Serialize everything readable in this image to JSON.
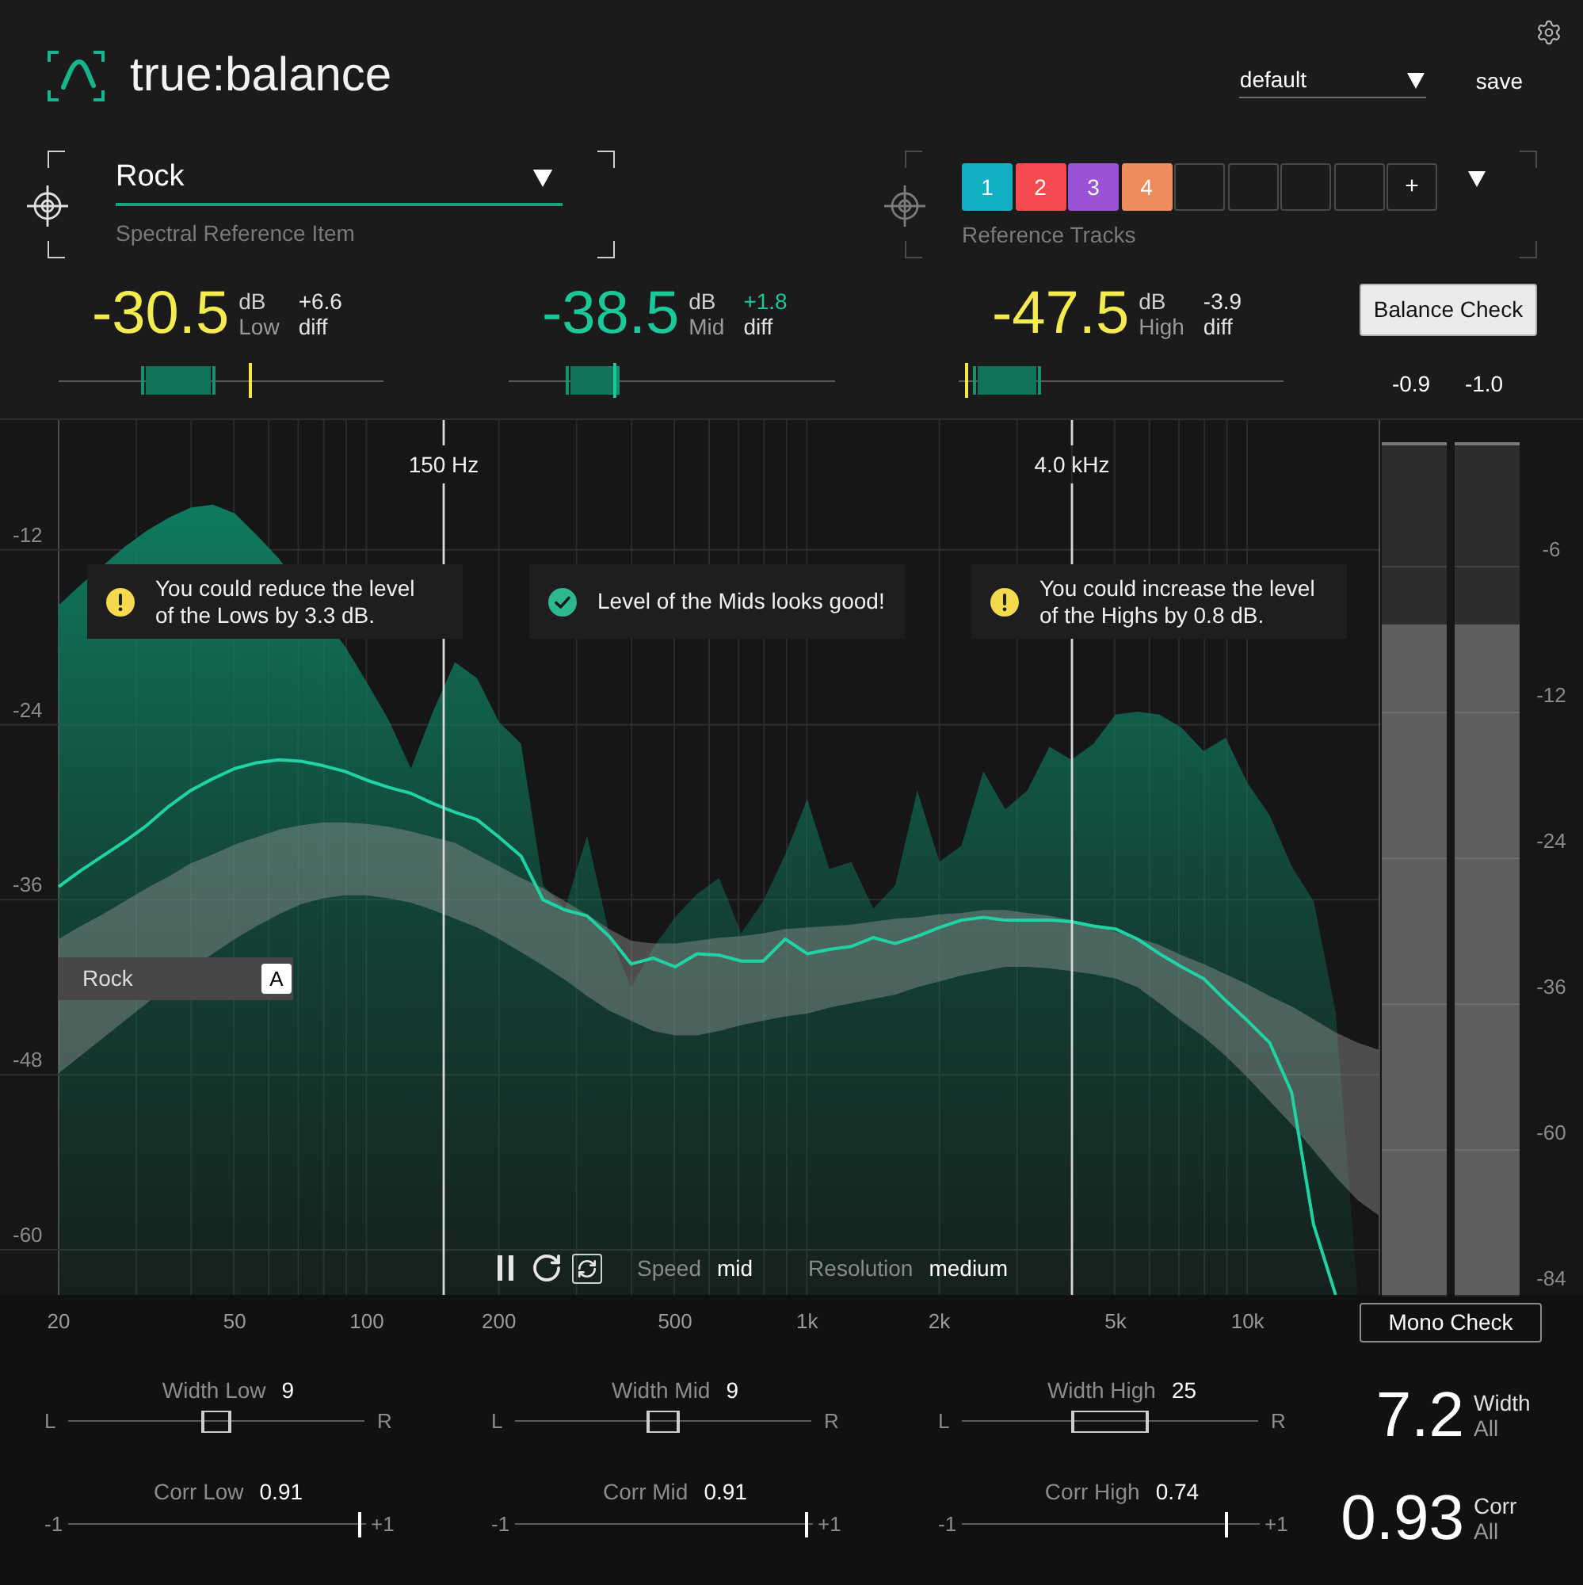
{
  "app": {
    "title": "true:balance"
  },
  "preset": {
    "value": "default"
  },
  "save_button": "save",
  "spectral_reference": {
    "value": "Rock",
    "label": "Spectral Reference Item"
  },
  "reference_tracks": {
    "label": "Reference Tracks",
    "slots": [
      {
        "kind": "track",
        "label": "1",
        "color": "#12b0c3"
      },
      {
        "kind": "track",
        "label": "2",
        "color": "#f34b4f"
      },
      {
        "kind": "track",
        "label": "3",
        "color": "#9c52d6"
      },
      {
        "kind": "track",
        "label": "4",
        "color": "#ee8c5c"
      },
      {
        "kind": "empty"
      },
      {
        "kind": "empty"
      },
      {
        "kind": "empty"
      },
      {
        "kind": "empty"
      },
      {
        "kind": "add",
        "label": "+"
      }
    ]
  },
  "band_meters": [
    {
      "value": "-30.5",
      "unit": "dB",
      "band": "Low",
      "diff": "+6.6",
      "diff_label": "diff",
      "on_target": false,
      "range_start": {
        "level": 0.26
      },
      "range_end": {
        "level": 0.48
      },
      "marker": {
        "level": 0.59
      }
    },
    {
      "value": "-38.5",
      "unit": "dB",
      "band": "Mid",
      "diff": "+1.8",
      "diff_label": "diff",
      "on_target": true,
      "range_start": {
        "level": 0.18
      },
      "range_end": {
        "level": 0.335
      },
      "marker": {
        "level": 0.325
      }
    },
    {
      "value": "-47.5",
      "unit": "dB",
      "band": "High",
      "diff": "-3.9",
      "diff_label": "diff",
      "on_target": false,
      "range_start": {
        "level": 0.05
      },
      "range_end": {
        "level": 0.25
      },
      "marker": {
        "level": 0.024
      }
    }
  ],
  "balance_check": "Balance Check",
  "output_meter": {
    "channels": [
      {
        "reading": "-0.9",
        "level": 0.79
      },
      {
        "reading": "-1.0",
        "level": 0.79
      }
    ],
    "scale": [
      "-6",
      "-12",
      "-24",
      "-36",
      "-60",
      "-84"
    ]
  },
  "spectrum": {
    "crossovers": [
      {
        "label": "150 Hz"
      },
      {
        "label": "4.0 kHz"
      }
    ],
    "hints": [
      {
        "kind": "warning",
        "lines": [
          "You could reduce the level",
          "of the Lows by 3.3 dB."
        ]
      },
      {
        "kind": "ok",
        "lines": [
          "Level of the Mids looks good!"
        ]
      },
      {
        "kind": "warning",
        "lines": [
          "You could increase the level",
          "of the Highs by 0.8 dB."
        ]
      }
    ],
    "reference_tag": {
      "text": "Rock",
      "badge": "A"
    },
    "controls": [
      {
        "label": "Speed",
        "value": "mid"
      },
      {
        "label": "Resolution",
        "value": "medium"
      }
    ],
    "chart_data": {
      "type": "area",
      "grid": true,
      "categories": [
        "20",
        null,
        null,
        null,
        null,
        null,
        null,
        null,
        "50",
        null,
        null,
        null,
        null,
        null,
        "100",
        null,
        null,
        null,
        null,
        null,
        "200",
        null,
        null,
        null,
        null,
        null,
        null,
        null,
        "500",
        null,
        null,
        null,
        null,
        null,
        "1k",
        null,
        null,
        null,
        null,
        null,
        "2k",
        null,
        null,
        null,
        null,
        null,
        null,
        null,
        "5k",
        null,
        null,
        null,
        null,
        null,
        "10k",
        null,
        null,
        null,
        null,
        null,
        null
      ],
      "ylim": [
        -63.1,
        -3.1
      ],
      "yticks": [
        -60,
        -48,
        -36,
        -24,
        -12
      ],
      "series": [
        {
          "color": "#0f7d60",
          "values": [
            -15.8,
            -14.4,
            -13.1,
            -11.8,
            -10.7,
            -9.8,
            -9.1,
            -8.9,
            -9.5,
            -11.0,
            -12.6,
            null,
            null,
            -18.6,
            -21.1,
            -23.7,
            -27.0,
            -23.1,
            -19.7,
            -20.8,
            -23.8,
            -25.3,
            -35.0,
            -36.6,
            -31.6,
            -38.3,
            -42.0,
            -39.3,
            -37.2,
            -35.6,
            -34.5,
            -38.3,
            -36.1,
            -32.9,
            -29.1,
            -33.9,
            -33.4,
            -36.6,
            -35.0,
            -28.5,
            -33.4,
            -32.3,
            -27.2,
            -29.8,
            -28.5,
            -25.5,
            -26.4,
            -25.3,
            -23.3,
            -23.1,
            -23.3,
            -24.2,
            -25.8,
            -24.9,
            -28.0,
            -30.2,
            -33.7,
            -36.1,
            -43.7,
            -63.1,
            null
          ]
        },
        {
          "type": "line",
          "color": "#1fd3a5",
          "values": [
            -35.1,
            -34.0,
            -33.0,
            -32.0,
            -30.9,
            -29.6,
            -28.5,
            -27.7,
            -27.0,
            -26.6,
            -26.4,
            -26.5,
            -26.8,
            -27.2,
            -27.8,
            -28.3,
            -28.7,
            -29.4,
            -30.0,
            -30.5,
            -31.7,
            -33.0,
            -36.0,
            -36.7,
            -37.1,
            -38.5,
            -40.4,
            -40.0,
            -40.6,
            -39.7,
            -39.8,
            -40.2,
            -40.2,
            -38.7,
            -39.7,
            -39.4,
            -39.2,
            -38.6,
            -39.0,
            -38.5,
            -37.9,
            -37.4,
            -37.2,
            -37.4,
            -37.4,
            -37.4,
            -37.5,
            -37.8,
            -38.0,
            -38.7,
            -39.7,
            -40.6,
            -41.4,
            -42.9,
            -44.3,
            -45.8,
            -49.2,
            -58.3,
            -63.1,
            null,
            null
          ]
        }
      ]
    }
  },
  "mono_check": "Mono Check",
  "width_sliders": [
    {
      "label": "Width Low",
      "value": "9",
      "left": "L",
      "right": "R",
      "range_start": {
        "level": 0.455
      },
      "range_end": {
        "level": 0.545
      }
    },
    {
      "label": "Width Mid",
      "value": "9",
      "left": "L",
      "right": "R",
      "range_start": {
        "level": 0.45
      },
      "range_end": {
        "level": 0.55
      }
    },
    {
      "label": "Width High",
      "value": "25",
      "left": "L",
      "right": "R",
      "range_start": {
        "level": 0.375
      },
      "range_end": {
        "level": 0.625
      }
    }
  ],
  "corr_meters": [
    {
      "label": "Corr Low",
      "value": "0.91",
      "min": "-1",
      "max": "+1",
      "level": 0.98
    },
    {
      "label": "Corr Mid",
      "value": "0.91",
      "min": "-1",
      "max": "+1",
      "level": 0.98
    },
    {
      "label": "Corr High",
      "value": "0.74",
      "min": "-1",
      "max": "+1",
      "level": 0.89
    }
  ],
  "summary": [
    {
      "value": "7.2",
      "label": "Width",
      "sublabel": "All"
    },
    {
      "value": "0.93",
      "label": "Corr",
      "sublabel": "All"
    }
  ]
}
